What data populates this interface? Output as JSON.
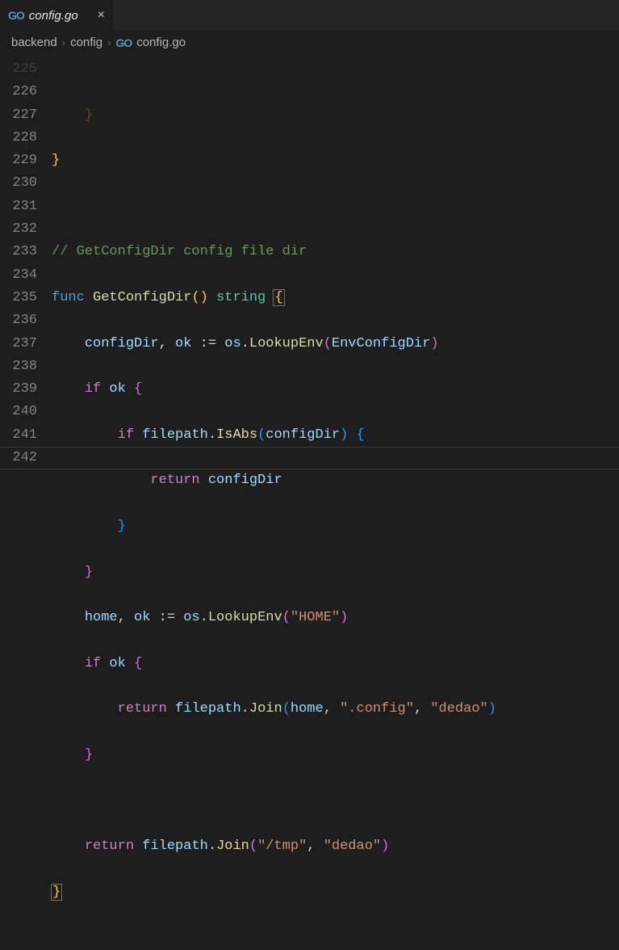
{
  "tab": {
    "icon_label": "GO",
    "filename": "config.go"
  },
  "breadcrumbs": {
    "parts": [
      "backend",
      "config",
      "config.go"
    ],
    "sep": "›",
    "last_icon": "GO"
  },
  "gutter": {
    "start": 226,
    "end": 242,
    "partial_top": "225"
  },
  "code": {
    "partial_top_brace": "}",
    "l226": "}",
    "l227": "",
    "l228_comment": "// GetConfigDir config file dir",
    "l229_func": "func",
    "l229_name": "GetConfigDir",
    "l229_ret": "string",
    "l230_v1": "configDir",
    "l230_v2": "ok",
    "l230_pkg": "os",
    "l230_call": "LookupEnv",
    "l230_arg": "EnvConfigDir",
    "l231_if": "if",
    "l231_cond": "ok",
    "l232_if": "if",
    "l232_pkg": "filepath",
    "l232_call": "IsAbs",
    "l232_arg": "configDir",
    "l233_ret": "return",
    "l233_val": "configDir",
    "l234_brace": "}",
    "l235_brace": "}",
    "l236_v1": "home",
    "l236_v2": "ok",
    "l236_pkg": "os",
    "l236_call": "LookupEnv",
    "l236_arg": "\"HOME\"",
    "l237_if": "if",
    "l237_cond": "ok",
    "l238_ret": "return",
    "l238_pkg": "filepath",
    "l238_call": "Join",
    "l238_a1": "home",
    "l238_a2": "\".config\"",
    "l238_a3": "\"dedao\"",
    "l239_brace": "}",
    "l240": "",
    "l241_ret": "return",
    "l241_pkg": "filepath",
    "l241_call": "Join",
    "l241_a1": "\"/tmp\"",
    "l241_a2": "\"dedao\"",
    "l242_brace": "}"
  }
}
